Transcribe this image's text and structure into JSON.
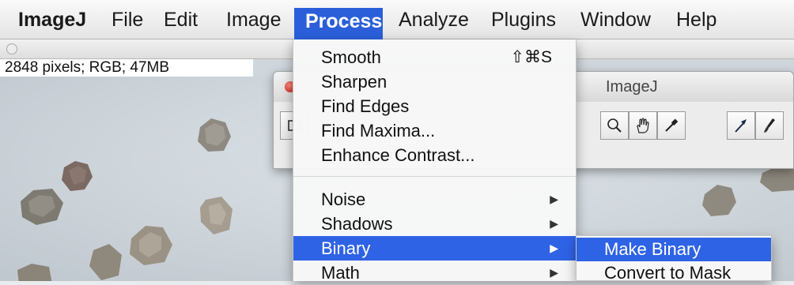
{
  "menubar": {
    "items": [
      {
        "label": "ImageJ"
      },
      {
        "label": "File"
      },
      {
        "label": "Edit"
      },
      {
        "label": "Image"
      },
      {
        "label": "Process"
      },
      {
        "label": "Analyze"
      },
      {
        "label": "Plugins"
      },
      {
        "label": "Window"
      },
      {
        "label": "Help"
      }
    ],
    "active_item": "Process",
    "highlight_color": "#2b5fd9"
  },
  "image_window": {
    "info": "2848 pixels; RGB; 47MB"
  },
  "toolbar_window": {
    "title": "ImageJ",
    "tools": [
      "rectangle-tool",
      "magnifier-tool",
      "hand-tool",
      "color-picker-tool",
      "arrow-tool",
      "brush-tool"
    ]
  },
  "process_menu": {
    "group1": [
      {
        "label": "Smooth",
        "shortcut": "⇧⌘S"
      },
      {
        "label": "Sharpen"
      },
      {
        "label": "Find Edges"
      },
      {
        "label": "Find Maxima..."
      },
      {
        "label": "Enhance Contrast..."
      }
    ],
    "group2": [
      {
        "label": "Noise",
        "submenu": "▶"
      },
      {
        "label": "Shadows",
        "submenu": "▶"
      },
      {
        "label": "Binary",
        "submenu": "▶"
      },
      {
        "label": "Math",
        "submenu": "▶"
      }
    ],
    "highlighted": "Binary",
    "highlight_color": "#2f63e6"
  },
  "binary_submenu": {
    "items": [
      {
        "label": "Make Binary"
      },
      {
        "label": "Convert to Mask"
      }
    ],
    "highlighted": "Make Binary"
  }
}
